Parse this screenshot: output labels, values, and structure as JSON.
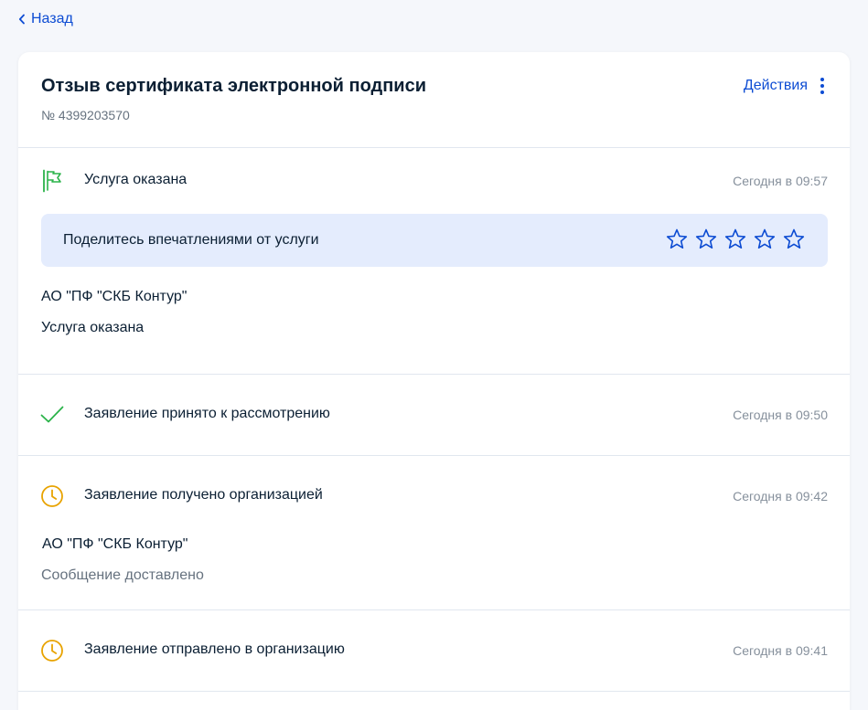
{
  "nav": {
    "back_label": "Назад"
  },
  "header": {
    "title": "Отзыв сертификата электронной подписи",
    "number": "№ 4399203570",
    "actions_label": "Действия"
  },
  "events": [
    {
      "title": "Услуга оказана",
      "time": "Сегодня в 09:57",
      "icon": "flag-icon",
      "feedback": {
        "text": "Поделитесь впечатлениями от услуги",
        "stars_total": 5,
        "stars_filled": 0
      },
      "org": "АО \"ПФ \"СКБ Контур\"",
      "status": "Услуга оказана"
    },
    {
      "title": "Заявление принято к рассмотрению",
      "time": "Сегодня в 09:50",
      "icon": "checkmark-icon"
    },
    {
      "title": "Заявление получено организацией",
      "time": "Сегодня в 09:42",
      "icon": "clock-icon",
      "org": "АО \"ПФ \"СКБ Контур\"",
      "status": "Сообщение доставлено"
    },
    {
      "title": "Заявление отправлено в организацию",
      "time": "Сегодня в 09:41",
      "icon": "clock-icon"
    }
  ],
  "colors": {
    "accent": "#0d4cd3",
    "success": "#2bb34a",
    "pending": "#e8a300",
    "feedback_bg": "#e4ecfd"
  }
}
